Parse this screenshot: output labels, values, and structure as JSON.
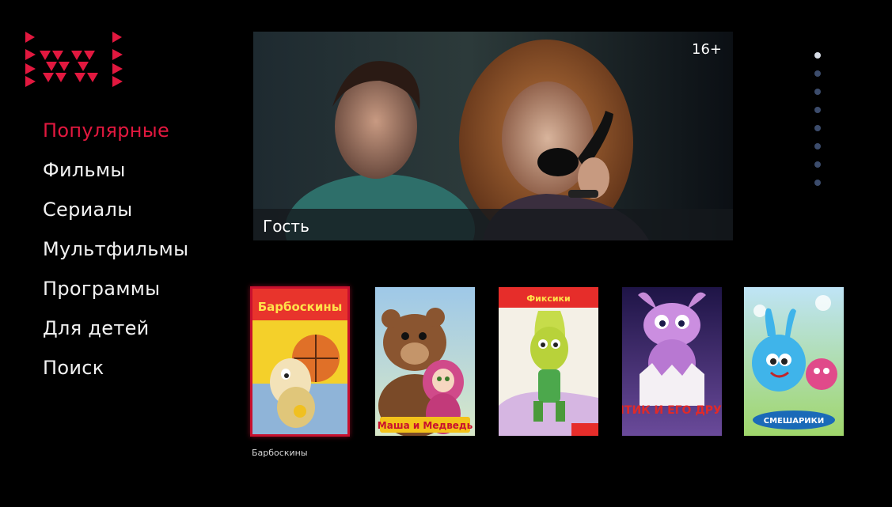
{
  "brand": {
    "accent_color": "#e2183f",
    "logo_icon": "ivi-logo-icon"
  },
  "menu": {
    "items": [
      {
        "label": "Популярные",
        "active": true
      },
      {
        "label": "Фильмы",
        "active": false
      },
      {
        "label": "Сериалы",
        "active": false
      },
      {
        "label": "Мультфильмы",
        "active": false
      },
      {
        "label": "Программы",
        "active": false
      },
      {
        "label": "Для детей",
        "active": false
      },
      {
        "label": "Поиск",
        "active": false
      }
    ]
  },
  "hero": {
    "title": "Гость",
    "age_rating": "16+"
  },
  "pager": {
    "count": 8,
    "active_index": 0
  },
  "posters": {
    "selected_index": 0,
    "selected_caption": "Барбоскины",
    "items": [
      {
        "art_text": "Барбоскины"
      },
      {
        "art_text": "Маша и Медведь"
      },
      {
        "art_text": "Фиксики"
      },
      {
        "art_text": "ЛУНТИК И ЕГО ДРУЗЬЯ"
      },
      {
        "art_text": "СМЕШАРИКИ"
      }
    ]
  }
}
